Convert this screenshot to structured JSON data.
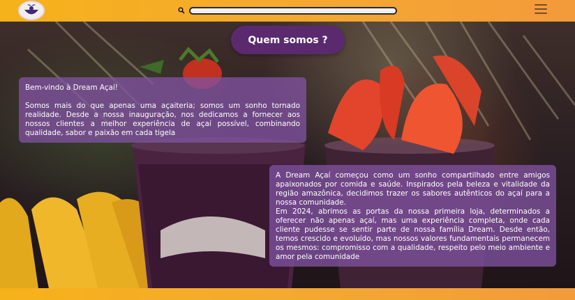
{
  "header": {
    "logo_alt": "Dream Açaí logo",
    "search": {
      "value": "",
      "placeholder": ""
    },
    "icons": {
      "search": "search-icon",
      "menu": "hamburger-menu-icon"
    }
  },
  "hero": {
    "title": "Quem somos ?",
    "welcome": {
      "greeting": "Bem-vindo à Dream Açaí!",
      "text": "Somos mais do que apenas uma açaiteria; somos um sonho tornado realidade. Desde a nossa inauguração, nos dedicamos a fornecer aos nossos clientes a melhor experiência de açaí possível, combinando qualidade, sabor e paixão em cada tigela"
    },
    "story": {
      "p1": "A Dream Açaí começou como um sonho compartilhado entre amigos apaixonados por comida e saúde. Inspirados pela beleza e vitalidade da região amazônica, decidimos trazer os sabores autênticos do açaí para a nossa comunidade.",
      "p2": "Em 2024, abrimos as portas da nossa primeira loja, determinados a oferecer não apenas açaí, mas uma experiência completa, onde cada cliente pudesse se sentir parte de nossa família Dream. Desde então, temos crescido e evoluído, mas nossos valores fundamentais permanecem os mesmos: compromisso com a qualidade, respeito pelo meio ambiente e amor pela comunidade"
    }
  },
  "colors": {
    "header": "#f4a832",
    "title_pill": "#5b2a6e",
    "card": "#8052a0"
  }
}
